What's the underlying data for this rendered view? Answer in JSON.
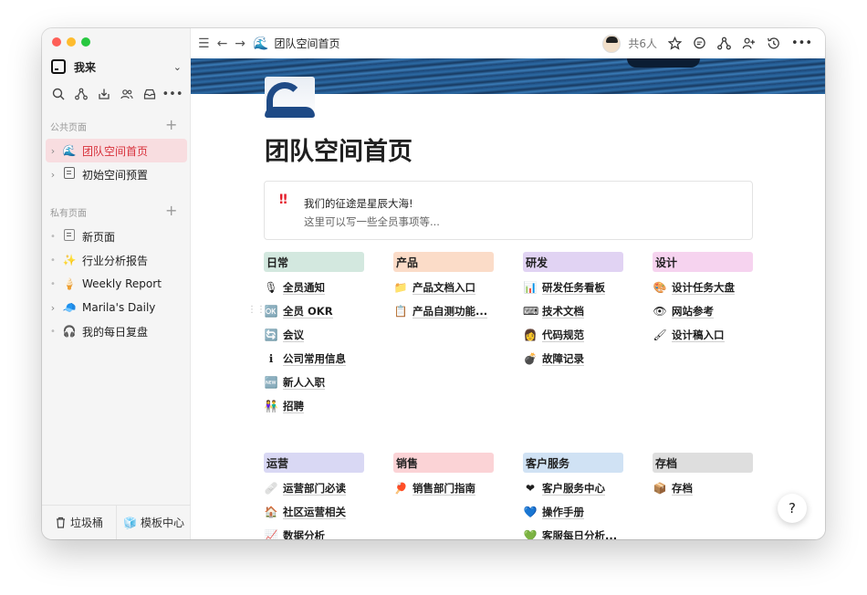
{
  "sidebar": {
    "workspace_name": "我来",
    "section_public": "公共页面",
    "section_private": "私有页面",
    "public_items": [
      {
        "label": "团队空间首页",
        "icon": "wave-icon"
      },
      {
        "label": "初始空间预置",
        "icon": "doc-icon"
      }
    ],
    "private_items": [
      {
        "label": "新页面",
        "icon": "blank-page-icon"
      },
      {
        "label": "行业分析报告",
        "icon": "sparkles-icon"
      },
      {
        "label": "Weekly Report",
        "icon": "ice-cream-icon"
      },
      {
        "label": "Marila's Daily",
        "icon": "cap-icon"
      },
      {
        "label": "我的每日复盘",
        "icon": "headphones-icon"
      }
    ],
    "footer": {
      "trash": "垃圾桶",
      "templates": "模板中心"
    }
  },
  "topbar": {
    "breadcrumb": "团队空间首页",
    "members": "共6人"
  },
  "page": {
    "title": "团队空间首页",
    "callout": {
      "icon": "!!",
      "line1": "我们的征途是星辰大海!",
      "line2": "这里可以写一些全员事项等..."
    }
  },
  "categories": [
    {
      "title": "日常",
      "color": "#d3e8df",
      "items": [
        {
          "emoji": "🎙",
          "label": "全员通知"
        },
        {
          "emoji": "🆗",
          "label": "全员 OKR"
        },
        {
          "emoji": "🔄",
          "label": "会议"
        },
        {
          "emoji": "ℹ",
          "label": "公司常用信息"
        },
        {
          "emoji": "🆕",
          "label": "新人入职"
        },
        {
          "emoji": "👫",
          "label": "招聘"
        }
      ]
    },
    {
      "title": "产品",
      "color": "#fbdcc8",
      "items": [
        {
          "emoji": "📁",
          "label": "产品文档入口"
        },
        {
          "emoji": "📋",
          "label": "产品自测功能..."
        }
      ]
    },
    {
      "title": "研发",
      "color": "#e1d3f3",
      "items": [
        {
          "emoji": "📊",
          "label": "研发任务看板"
        },
        {
          "emoji": "⌨",
          "label": "技术文档"
        },
        {
          "emoji": "👩",
          "label": "代码规范"
        },
        {
          "emoji": "💣",
          "label": "故障记录"
        }
      ]
    },
    {
      "title": "设计",
      "color": "#f6d3ef",
      "items": [
        {
          "emoji": "🎨",
          "label": "设计任务大盘"
        },
        {
          "emoji": "👁",
          "label": "网站参考"
        },
        {
          "emoji": "🖌",
          "label": "设计稿入口"
        }
      ]
    },
    {
      "title": "运营",
      "color": "#d9d8f4",
      "items": [
        {
          "emoji": "🩹",
          "label": "运营部门必读"
        },
        {
          "emoji": "🏠",
          "label": "社区运营相关"
        },
        {
          "emoji": "📈",
          "label": "数据分析"
        }
      ]
    },
    {
      "title": "销售",
      "color": "#fbd3d6",
      "items": [
        {
          "emoji": "🏓",
          "label": "销售部门指南"
        }
      ]
    },
    {
      "title": "客户服务",
      "color": "#d0e2f4",
      "items": [
        {
          "emoji": "❤",
          "label": "客户服务中心"
        },
        {
          "emoji": "💙",
          "label": "操作手册"
        },
        {
          "emoji": "💚",
          "label": "客服每日分析..."
        }
      ]
    },
    {
      "title": "存档",
      "color": "#dedede",
      "items": [
        {
          "emoji": "📦",
          "label": "存档"
        }
      ]
    }
  ],
  "help_label": "?"
}
